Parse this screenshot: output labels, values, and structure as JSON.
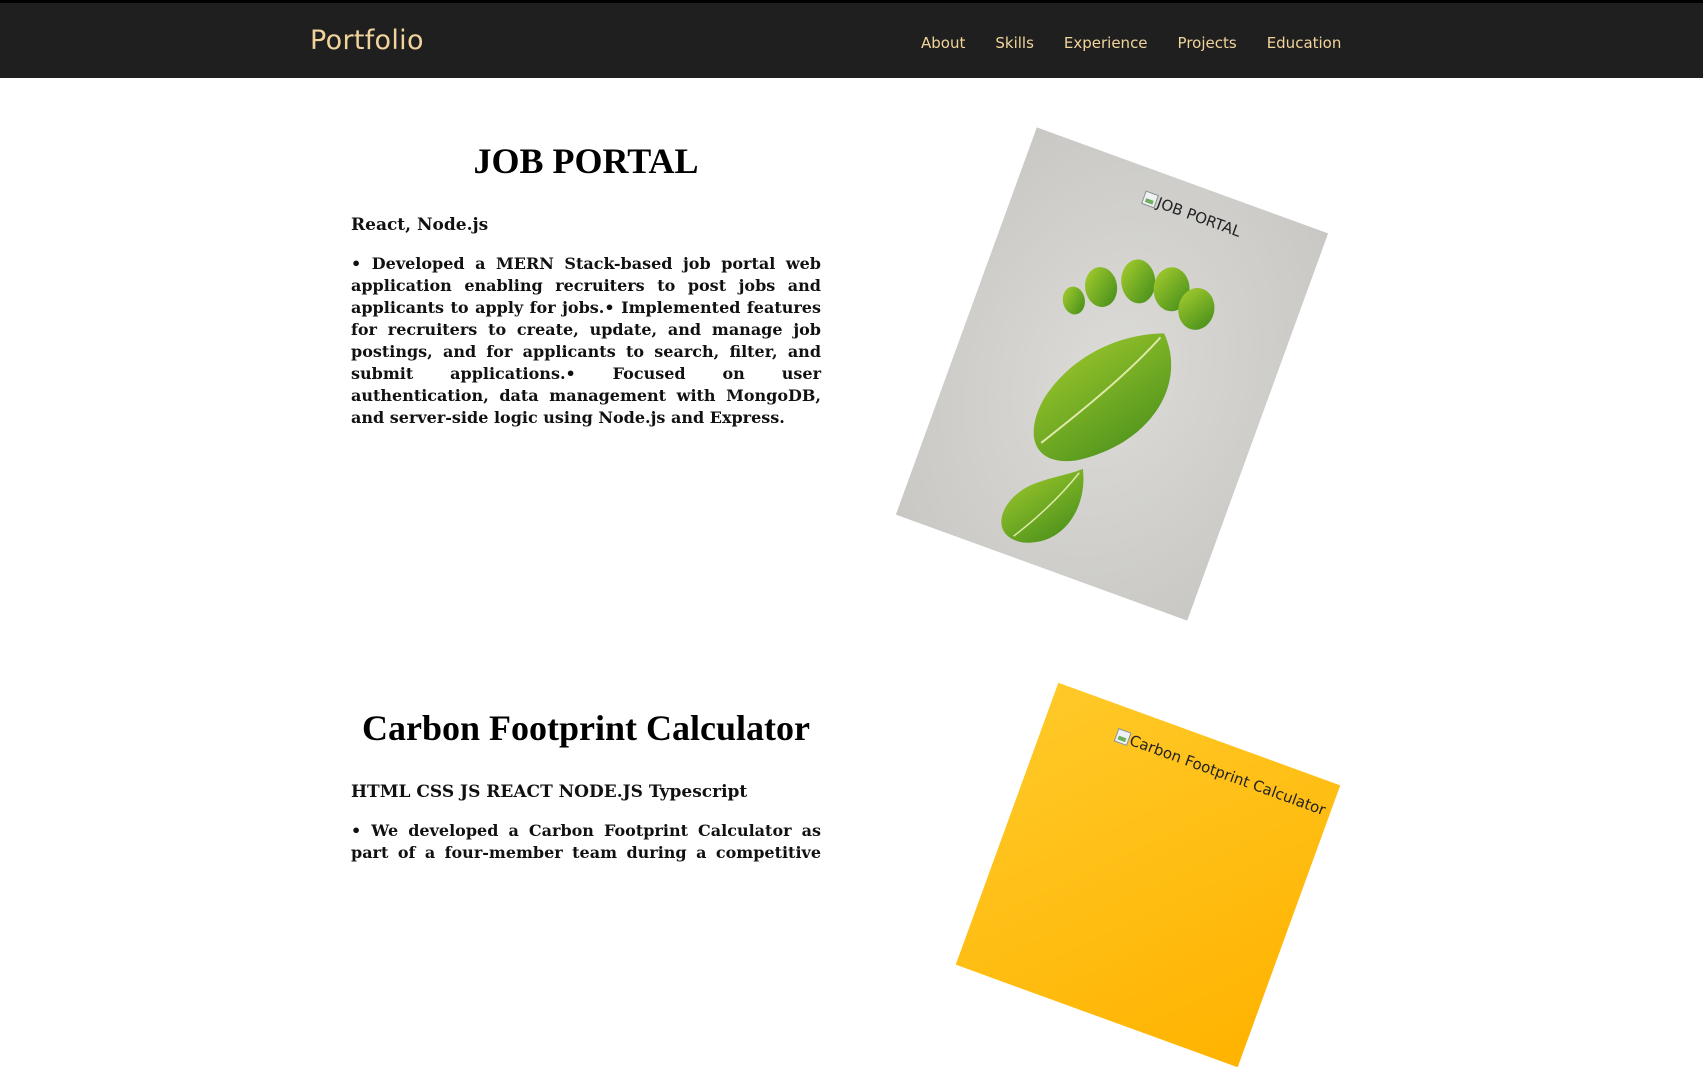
{
  "header": {
    "logo": "Portfolio",
    "nav": [
      "About",
      "Skills",
      "Experience",
      "Projects",
      "Education"
    ]
  },
  "projects": [
    {
      "title": "JOB PORTAL",
      "tech": "React, Node.js",
      "description": "• Developed a MERN Stack-based job portal web application enabling recruiters to post jobs and applicants to apply for jobs.• Implemented features for recruiters to create, update, and manage job postings, and for applicants to search, filter, and submit applications.• Focused on user authentication, data management with MongoDB, and server-side logic using Node.js and Express.",
      "image_alt": "JOB PORTAL",
      "image_icon": "leaf-footprint-image"
    },
    {
      "title": "Carbon Footprint Calculator",
      "tech": "HTML CSS JS REACT NODE.JS Typescript",
      "description": "• We developed a Carbon Footprint Calculator as part of a four-member team during a competitive hackathon. •",
      "image_alt": "Carbon Footprint Calculator",
      "image_icon": "yellow-gradient-image"
    }
  ],
  "colors": {
    "header_bg": "#1f1f1f",
    "accent": "#f1d49c",
    "card_yellow": "#ffc107"
  }
}
